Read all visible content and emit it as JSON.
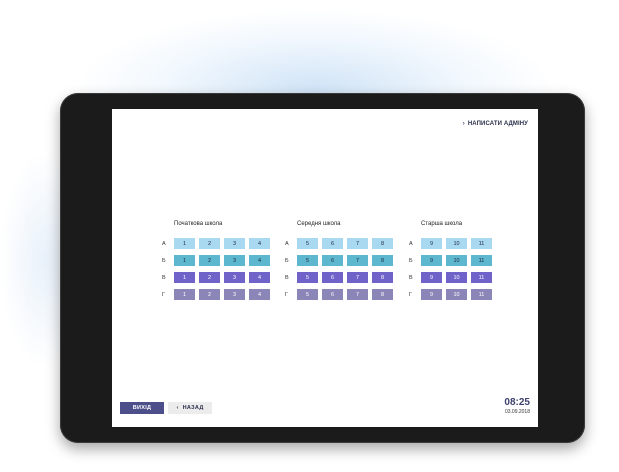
{
  "header": {
    "admin_link_label": "НАПИСАТИ АДМІНУ",
    "admin_link_icon": "chevron-right-icon"
  },
  "colors": {
    "row_a": "#a8d9f0",
    "row_b": "#5cb7cf",
    "row_v": "#6f63c9",
    "row_g": "#8a87b8"
  },
  "groups": [
    {
      "title": "Початкова школа",
      "rows": [
        {
          "label": "А",
          "cells": [
            "1",
            "2",
            "3",
            "4"
          ]
        },
        {
          "label": "Б",
          "cells": [
            "1",
            "2",
            "3",
            "4"
          ]
        },
        {
          "label": "В",
          "cells": [
            "1",
            "2",
            "3",
            "4"
          ]
        },
        {
          "label": "Г",
          "cells": [
            "1",
            "2",
            "3",
            "4"
          ]
        }
      ]
    },
    {
      "title": "Середня школа",
      "rows": [
        {
          "label": "А",
          "cells": [
            "5",
            "6",
            "7",
            "8"
          ]
        },
        {
          "label": "Б",
          "cells": [
            "5",
            "6",
            "7",
            "8"
          ]
        },
        {
          "label": "В",
          "cells": [
            "5",
            "6",
            "7",
            "8"
          ]
        },
        {
          "label": "Г",
          "cells": [
            "5",
            "6",
            "7",
            "8"
          ]
        }
      ]
    },
    {
      "title": "Старша школа",
      "rows": [
        {
          "label": "А",
          "cells": [
            "9",
            "10",
            "11"
          ]
        },
        {
          "label": "Б",
          "cells": [
            "9",
            "10",
            "11"
          ]
        },
        {
          "label": "В",
          "cells": [
            "9",
            "10",
            "11"
          ]
        },
        {
          "label": "Г",
          "cells": [
            "9",
            "10",
            "11"
          ]
        }
      ]
    }
  ],
  "footer": {
    "exit_label": "ВИХІД",
    "back_label": "НАЗАД",
    "back_icon": "chevron-left-icon",
    "time": "08:25",
    "date": "03.09.2018"
  }
}
